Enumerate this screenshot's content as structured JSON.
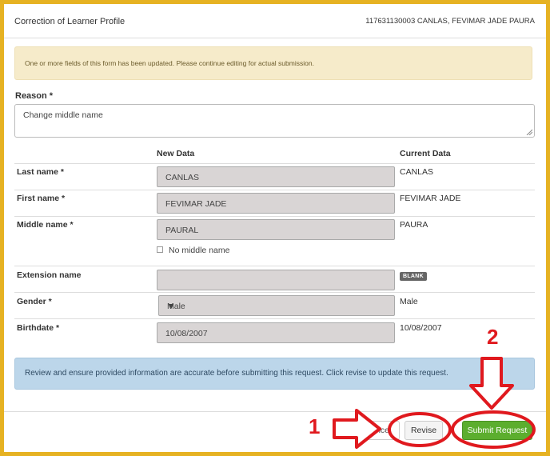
{
  "header": {
    "title": "Correction of Learner Profile",
    "learner": "117631130003 CANLAS, FEVIMAR JADE PAURA"
  },
  "notice": "One or more fields of this form has been updated. Please continue editing for actual submission.",
  "reason": {
    "label": "Reason *",
    "value": "Change middle name"
  },
  "columns": {
    "new": "New Data",
    "current": "Current Data"
  },
  "rows": {
    "last_name": {
      "label": "Last name *",
      "new": "CANLAS",
      "current": "CANLAS"
    },
    "first_name": {
      "label": "First name *",
      "new": "FEVIMAR JADE",
      "current": "FEVIMAR JADE"
    },
    "middle_name": {
      "label": "Middle name *",
      "new": "PAURAL",
      "current": "PAURA",
      "checkbox_label": "No middle name"
    },
    "extension_name": {
      "label": "Extension name",
      "new": "",
      "current_badge": "BLANK"
    },
    "gender": {
      "label": "Gender *",
      "new": "Male",
      "current": "Male"
    },
    "birthdate": {
      "label": "Birthdate *",
      "new": "10/08/2007",
      "current": "10/08/2007"
    }
  },
  "info": "Review and ensure provided information are accurate before submitting this request. Click revise to update this request.",
  "buttons": {
    "cancel": "Cancel",
    "revise": "Revise",
    "submit": "Submit Request"
  },
  "annotations": {
    "step1": "1",
    "step2": "2",
    "color": "#e0191e"
  },
  "colors": {
    "background_frame": "#e6b222",
    "submit_green": "#5cae2e",
    "info_blue": "#bcd6ea",
    "warn_yellow": "#f6ebca"
  }
}
